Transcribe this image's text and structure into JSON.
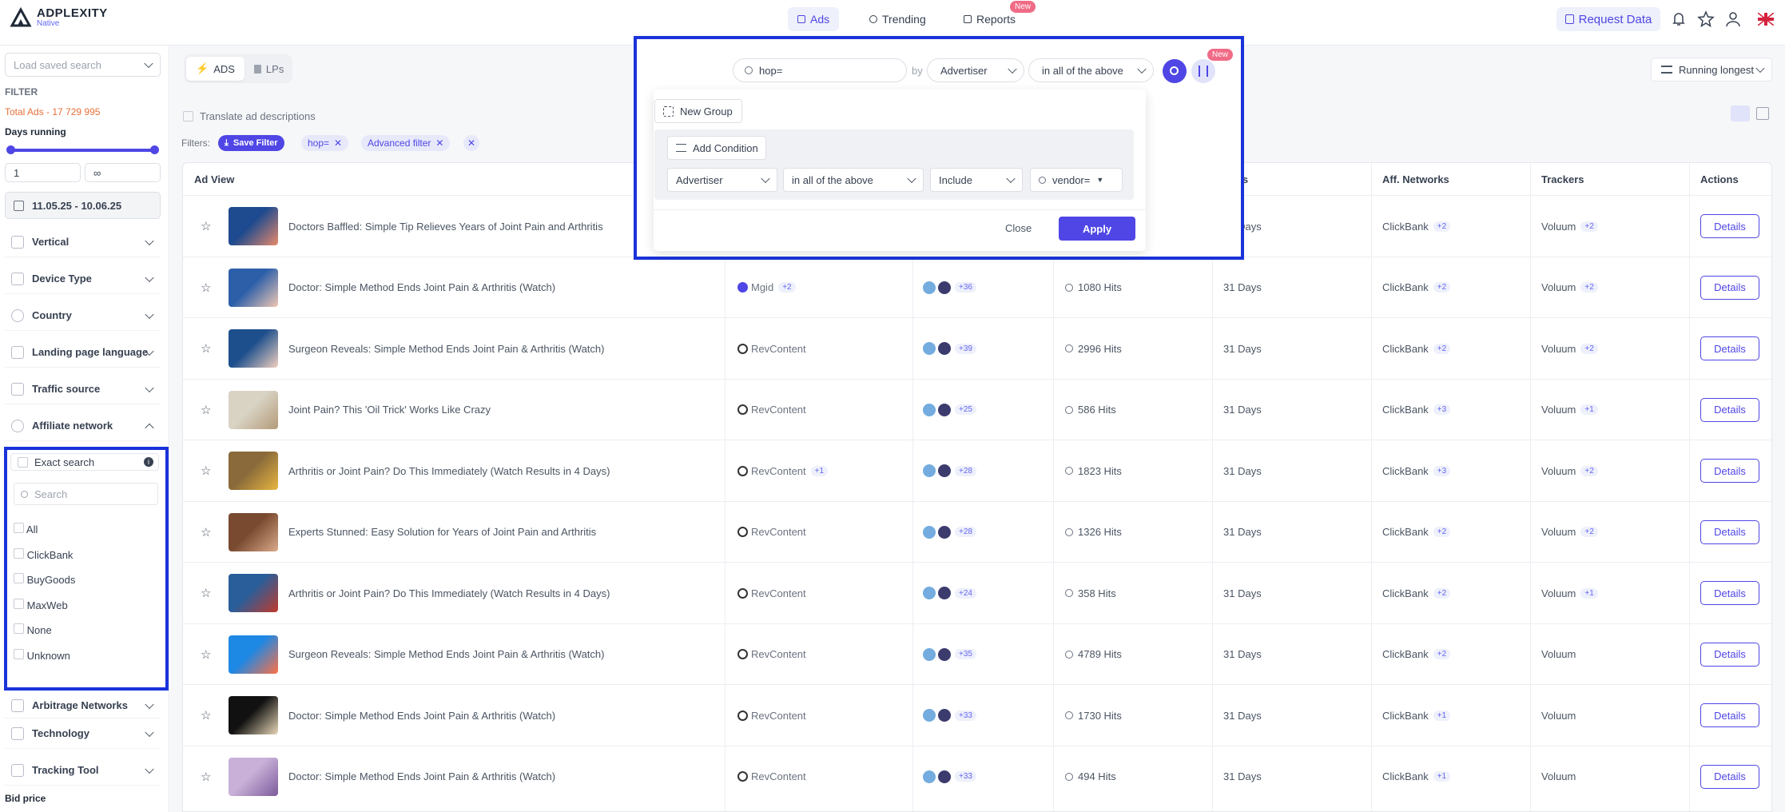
{
  "app": {
    "brand": "ADPLEXITY",
    "brand_sub": "Native"
  },
  "topnav": {
    "ads": "Ads",
    "trending": "Trending",
    "reports": "Reports",
    "reports_badge": "New",
    "request": "Request Data"
  },
  "sidebar": {
    "saved_search_placeholder": "Load saved search",
    "filter_label": "FILTER",
    "total_ads": "Total Ads - 17 729 995",
    "days_running": "Days running",
    "days_min": "1",
    "days_max": "∞",
    "date_range": "11.05.25 - 10.06.25",
    "items": [
      "Vertical",
      "Device Type",
      "Country",
      "Landing page language",
      "Traffic source",
      "Affiliate network",
      "Arbitrage Networks",
      "Technology",
      "Tracking Tool"
    ],
    "bid_price": "Bid price",
    "exact_search": "Exact search",
    "network_search_placeholder": "Search",
    "networks": [
      "All",
      "ClickBank",
      "BuyGoods",
      "MaxWeb",
      "None",
      "Unknown"
    ]
  },
  "toolbar": {
    "tab_ads": "ADS",
    "tab_lps": "LPs",
    "translate": "Translate ad descriptions",
    "filters_label": "Filters:",
    "save_filter": "Save Filter",
    "chips": [
      "hop=",
      "Advanced filter"
    ],
    "sort": "Running longest"
  },
  "search": {
    "query": "hop=",
    "by": "by",
    "field": "Advertiser",
    "scope": "in all of the above",
    "new_badge": "New"
  },
  "advanced": {
    "new_group": "New Group",
    "add_condition": "Add Condition",
    "cond_field": "Advertiser",
    "cond_scope": "in all of the above",
    "cond_mode": "Include",
    "cond_value": "vendor=",
    "close": "Close",
    "apply": "Apply"
  },
  "table": {
    "headers": {
      "ad_view": "Ad View",
      "days": "Days",
      "aff": "Aff. Networks",
      "trackers": "Trackers",
      "actions": "Actions"
    },
    "rows": [
      {
        "title": "Doctors Baffled: Simple Tip Relieves Years of Joint Pain and Arthritis",
        "network": "",
        "net_more": "",
        "geo_more": "",
        "hits": "",
        "days": "31 Days",
        "aff": "ClickBank",
        "aff_more": "+2",
        "tracker": "Voluum",
        "tr_more": "+2",
        "btn": "Details"
      },
      {
        "title": "Doctor: Simple Method Ends Joint Pain & Arthritis (Watch)",
        "network": "Mgid",
        "net_more": "+2",
        "geo_more": "+36",
        "hits": "1080 Hits",
        "days": "31 Days",
        "aff": "ClickBank",
        "aff_more": "+2",
        "tracker": "Voluum",
        "tr_more": "+2",
        "btn": "Details"
      },
      {
        "title": "Surgeon Reveals: Simple Method Ends Joint Pain & Arthritis (Watch)",
        "network": "RevContent",
        "net_more": "",
        "geo_more": "+39",
        "hits": "2996 Hits",
        "days": "31 Days",
        "aff": "ClickBank",
        "aff_more": "+2",
        "tracker": "Voluum",
        "tr_more": "+2",
        "btn": "Details"
      },
      {
        "title": "Joint Pain? This 'Oil Trick' Works Like Crazy",
        "network": "RevContent",
        "net_more": "",
        "geo_more": "+25",
        "hits": "586 Hits",
        "days": "31 Days",
        "aff": "ClickBank",
        "aff_more": "+3",
        "tracker": "Voluum",
        "tr_more": "+1",
        "btn": "Details"
      },
      {
        "title": "Arthritis or Joint Pain? Do This Immediately (Watch Results in 4 Days)",
        "network": "RevContent",
        "net_more": "+1",
        "geo_more": "+28",
        "hits": "1823 Hits",
        "days": "31 Days",
        "aff": "ClickBank",
        "aff_more": "+3",
        "tracker": "Voluum",
        "tr_more": "+2",
        "btn": "Details"
      },
      {
        "title": "Experts Stunned: Easy Solution for Years of Joint Pain and Arthritis",
        "network": "RevContent",
        "net_more": "",
        "geo_more": "+28",
        "hits": "1326 Hits",
        "days": "31 Days",
        "aff": "ClickBank",
        "aff_more": "+2",
        "tracker": "Voluum",
        "tr_more": "+2",
        "btn": "Details"
      },
      {
        "title": "Arthritis or Joint Pain? Do This Immediately (Watch Results in 4 Days)",
        "network": "RevContent",
        "net_more": "",
        "geo_more": "+24",
        "hits": "358 Hits",
        "days": "31 Days",
        "aff": "ClickBank",
        "aff_more": "+2",
        "tracker": "Voluum",
        "tr_more": "+1",
        "btn": "Details"
      },
      {
        "title": "Surgeon Reveals: Simple Method Ends Joint Pain & Arthritis (Watch)",
        "network": "RevContent",
        "net_more": "",
        "geo_more": "+35",
        "hits": "4789 Hits",
        "days": "31 Days",
        "aff": "ClickBank",
        "aff_more": "+2",
        "tracker": "Voluum",
        "tr_more": "",
        "btn": "Details"
      },
      {
        "title": "Doctor: Simple Method Ends Joint Pain & Arthritis (Watch)",
        "network": "RevContent",
        "net_more": "",
        "geo_more": "+33",
        "hits": "1730 Hits",
        "days": "31 Days",
        "aff": "ClickBank",
        "aff_more": "+1",
        "tracker": "Voluum",
        "tr_more": "",
        "btn": "Details"
      },
      {
        "title": "Doctor: Simple Method Ends Joint Pain & Arthritis (Watch)",
        "network": "RevContent",
        "net_more": "",
        "geo_more": "+33",
        "hits": "494 Hits",
        "days": "31 Days",
        "aff": "ClickBank",
        "aff_more": "+1",
        "tracker": "Voluum",
        "tr_more": "",
        "btn": "Details"
      }
    ]
  }
}
